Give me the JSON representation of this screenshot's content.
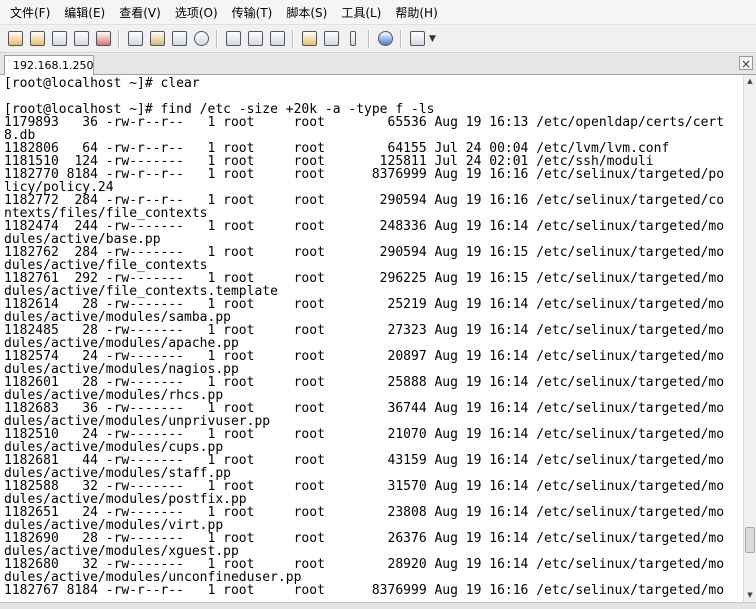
{
  "menu": {
    "items": [
      {
        "label": "文件(F)"
      },
      {
        "label": "编辑(E)"
      },
      {
        "label": "查看(V)"
      },
      {
        "label": "选项(O)"
      },
      {
        "label": "传输(T)"
      },
      {
        "label": "脚本(S)"
      },
      {
        "label": "工具(L)"
      },
      {
        "label": "帮助(H)"
      }
    ]
  },
  "toolbar": {
    "icons": [
      "connect-icon",
      "quick-connect-icon",
      "connect-tab-icon",
      "reconnect-icon",
      "disconnect-icon",
      "copy-icon",
      "paste-icon",
      "copy-paste-icon",
      "find-icon",
      "print-icon",
      "print-setup-icon",
      "print-screen-icon",
      "session-options-icon",
      "global-options-icon",
      "keymap-icon",
      "help-icon",
      "sftp-icon"
    ]
  },
  "session_tab": {
    "label": "192.168.1.250",
    "close_label": "×"
  },
  "terminal": {
    "lines": [
      "[root@localhost ~]# clear",
      "",
      "[root@localhost ~]# find /etc -size +20k -a -type f -ls",
      "1179893   36 -rw-r--r--   1 root     root        65536 Aug 19 16:13 /etc/openldap/certs/cert",
      "8.db",
      "1182806   64 -rw-r--r--   1 root     root        64155 Jul 24 00:04 /etc/lvm/lvm.conf",
      "1181510  124 -rw-------   1 root     root       125811 Jul 24 02:01 /etc/ssh/moduli",
      "1182770 8184 -rw-r--r--   1 root     root      8376999 Aug 19 16:16 /etc/selinux/targeted/po",
      "licy/policy.24",
      "1182772  284 -rw-r--r--   1 root     root       290594 Aug 19 16:16 /etc/selinux/targeted/co",
      "ntexts/files/file_contexts",
      "1182474  244 -rw-------   1 root     root       248336 Aug 19 16:14 /etc/selinux/targeted/mo",
      "dules/active/base.pp",
      "1182762  284 -rw-------   1 root     root       290594 Aug 19 16:15 /etc/selinux/targeted/mo",
      "dules/active/file_contexts",
      "1182761  292 -rw-------   1 root     root       296225 Aug 19 16:15 /etc/selinux/targeted/mo",
      "dules/active/file_contexts.template",
      "1182614   28 -rw-------   1 root     root        25219 Aug 19 16:14 /etc/selinux/targeted/mo",
      "dules/active/modules/samba.pp",
      "1182485   28 -rw-------   1 root     root        27323 Aug 19 16:14 /etc/selinux/targeted/mo",
      "dules/active/modules/apache.pp",
      "1182574   24 -rw-------   1 root     root        20897 Aug 19 16:14 /etc/selinux/targeted/mo",
      "dules/active/modules/nagios.pp",
      "1182601   28 -rw-------   1 root     root        25888 Aug 19 16:14 /etc/selinux/targeted/mo",
      "dules/active/modules/rhcs.pp",
      "1182683   36 -rw-------   1 root     root        36744 Aug 19 16:14 /etc/selinux/targeted/mo",
      "dules/active/modules/unprivuser.pp",
      "1182510   24 -rw-------   1 root     root        21070 Aug 19 16:14 /etc/selinux/targeted/mo",
      "dules/active/modules/cups.pp",
      "1182681   44 -rw-------   1 root     root        43159 Aug 19 16:14 /etc/selinux/targeted/mo",
      "dules/active/modules/staff.pp",
      "1182588   32 -rw-------   1 root     root        31570 Aug 19 16:14 /etc/selinux/targeted/mo",
      "dules/active/modules/postfix.pp",
      "1182651   24 -rw-------   1 root     root        23808 Aug 19 16:14 /etc/selinux/targeted/mo",
      "dules/active/modules/virt.pp",
      "1182690   28 -rw-------   1 root     root        26376 Aug 19 16:14 /etc/selinux/targeted/mo",
      "dules/active/modules/xguest.pp",
      "1182680   32 -rw-------   1 root     root        28920 Aug 19 16:14 /etc/selinux/targeted/mo",
      "dules/active/modules/unconfineduser.pp",
      "1182767 8184 -rw-r--r--   1 root     root      8376999 Aug 19 16:16 /etc/selinux/targeted/mo"
    ]
  }
}
